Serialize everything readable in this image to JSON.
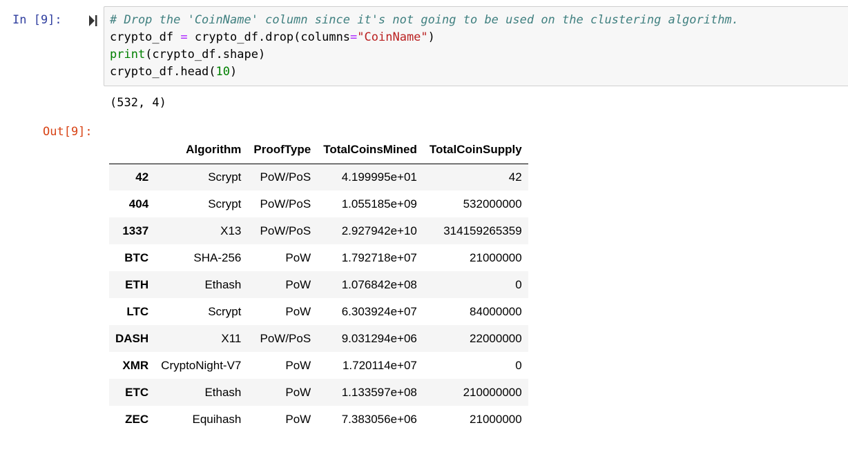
{
  "input_cell": {
    "prompt": "In [9]:",
    "code": {
      "line1_comment": "# Drop the 'CoinName' column since it's not going to be used on the clustering algorithm.",
      "line2_var": "crypto_df",
      "line2_eq": "=",
      "line2_call": "crypto_df.drop(columns",
      "line2_eq2": "=",
      "line2_str": "\"CoinName\"",
      "line2_close": ")",
      "line3_builtin": "print",
      "line3_rest": "(crypto_df.shape)",
      "line4_start": "crypto_df.head(",
      "line4_num": "10",
      "line4_end": ")"
    }
  },
  "stdout": "(532, 4)",
  "output_cell": {
    "prompt": "Out[9]:",
    "table": {
      "columns": [
        "",
        "Algorithm",
        "ProofType",
        "TotalCoinsMined",
        "TotalCoinSupply"
      ],
      "rows": [
        {
          "index": "42",
          "cells": [
            "Scrypt",
            "PoW/PoS",
            "4.199995e+01",
            "42"
          ]
        },
        {
          "index": "404",
          "cells": [
            "Scrypt",
            "PoW/PoS",
            "1.055185e+09",
            "532000000"
          ]
        },
        {
          "index": "1337",
          "cells": [
            "X13",
            "PoW/PoS",
            "2.927942e+10",
            "314159265359"
          ]
        },
        {
          "index": "BTC",
          "cells": [
            "SHA-256",
            "PoW",
            "1.792718e+07",
            "21000000"
          ]
        },
        {
          "index": "ETH",
          "cells": [
            "Ethash",
            "PoW",
            "1.076842e+08",
            "0"
          ]
        },
        {
          "index": "LTC",
          "cells": [
            "Scrypt",
            "PoW",
            "6.303924e+07",
            "84000000"
          ]
        },
        {
          "index": "DASH",
          "cells": [
            "X11",
            "PoW/PoS",
            "9.031294e+06",
            "22000000"
          ]
        },
        {
          "index": "XMR",
          "cells": [
            "CryptoNight-V7",
            "PoW",
            "1.720114e+07",
            "0"
          ]
        },
        {
          "index": "ETC",
          "cells": [
            "Ethash",
            "PoW",
            "1.133597e+08",
            "210000000"
          ]
        },
        {
          "index": "ZEC",
          "cells": [
            "Equihash",
            "PoW",
            "7.383056e+06",
            "21000000"
          ]
        }
      ]
    }
  },
  "icons": {
    "run": "run-cell-icon"
  },
  "colors": {
    "in_prompt": "#303F9F",
    "out_prompt": "#D84315",
    "comment": "#408080",
    "string": "#BA2121",
    "builtin": "#008000",
    "operator": "#AA22FF"
  }
}
